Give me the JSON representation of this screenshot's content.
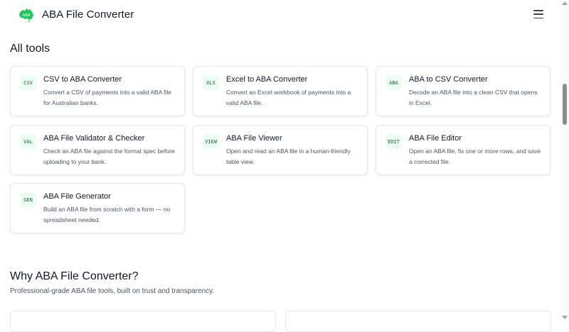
{
  "header": {
    "logo_text": "ABA",
    "brand": "ABA File Converter",
    "menu_icon": "hamburger-menu-icon"
  },
  "all_tools": {
    "title": "All tools",
    "items": [
      {
        "badge": "CSV",
        "title": "CSV to ABA Converter",
        "desc": "Convert a CSV of payments into a valid ABA file for Australian banks."
      },
      {
        "badge": "XLS",
        "title": "Excel to ABA Converter",
        "desc": "Convert an Excel workbook of payments into a valid ABA file."
      },
      {
        "badge": "ABA",
        "title": "ABA to CSV Converter",
        "desc": "Decode an ABA file into a clean CSV that opens in Excel."
      },
      {
        "badge": "VAL",
        "title": "ABA File Validator & Checker",
        "desc": "Check an ABA file against the format spec before uploading to your bank."
      },
      {
        "badge": "VIEW",
        "title": "ABA File Viewer",
        "desc": "Open and read an ABA file in a human-friendly table view."
      },
      {
        "badge": "EDIT",
        "title": "ABA File Editor",
        "desc": "Open an ABA file, fix one or more rows, and save a corrected file."
      },
      {
        "badge": "GEN",
        "title": "ABA File Generator",
        "desc": "Build an ABA file from scratch with a form — no spreadsheet needed."
      }
    ]
  },
  "why": {
    "title": "Why ABA File Converter?",
    "subtitle": "Professional-grade ABA file tools, built on trust and transparency."
  },
  "colors": {
    "accent": "#22c55e",
    "badge_bg": "#ecfdf3",
    "badge_text": "#166534"
  }
}
